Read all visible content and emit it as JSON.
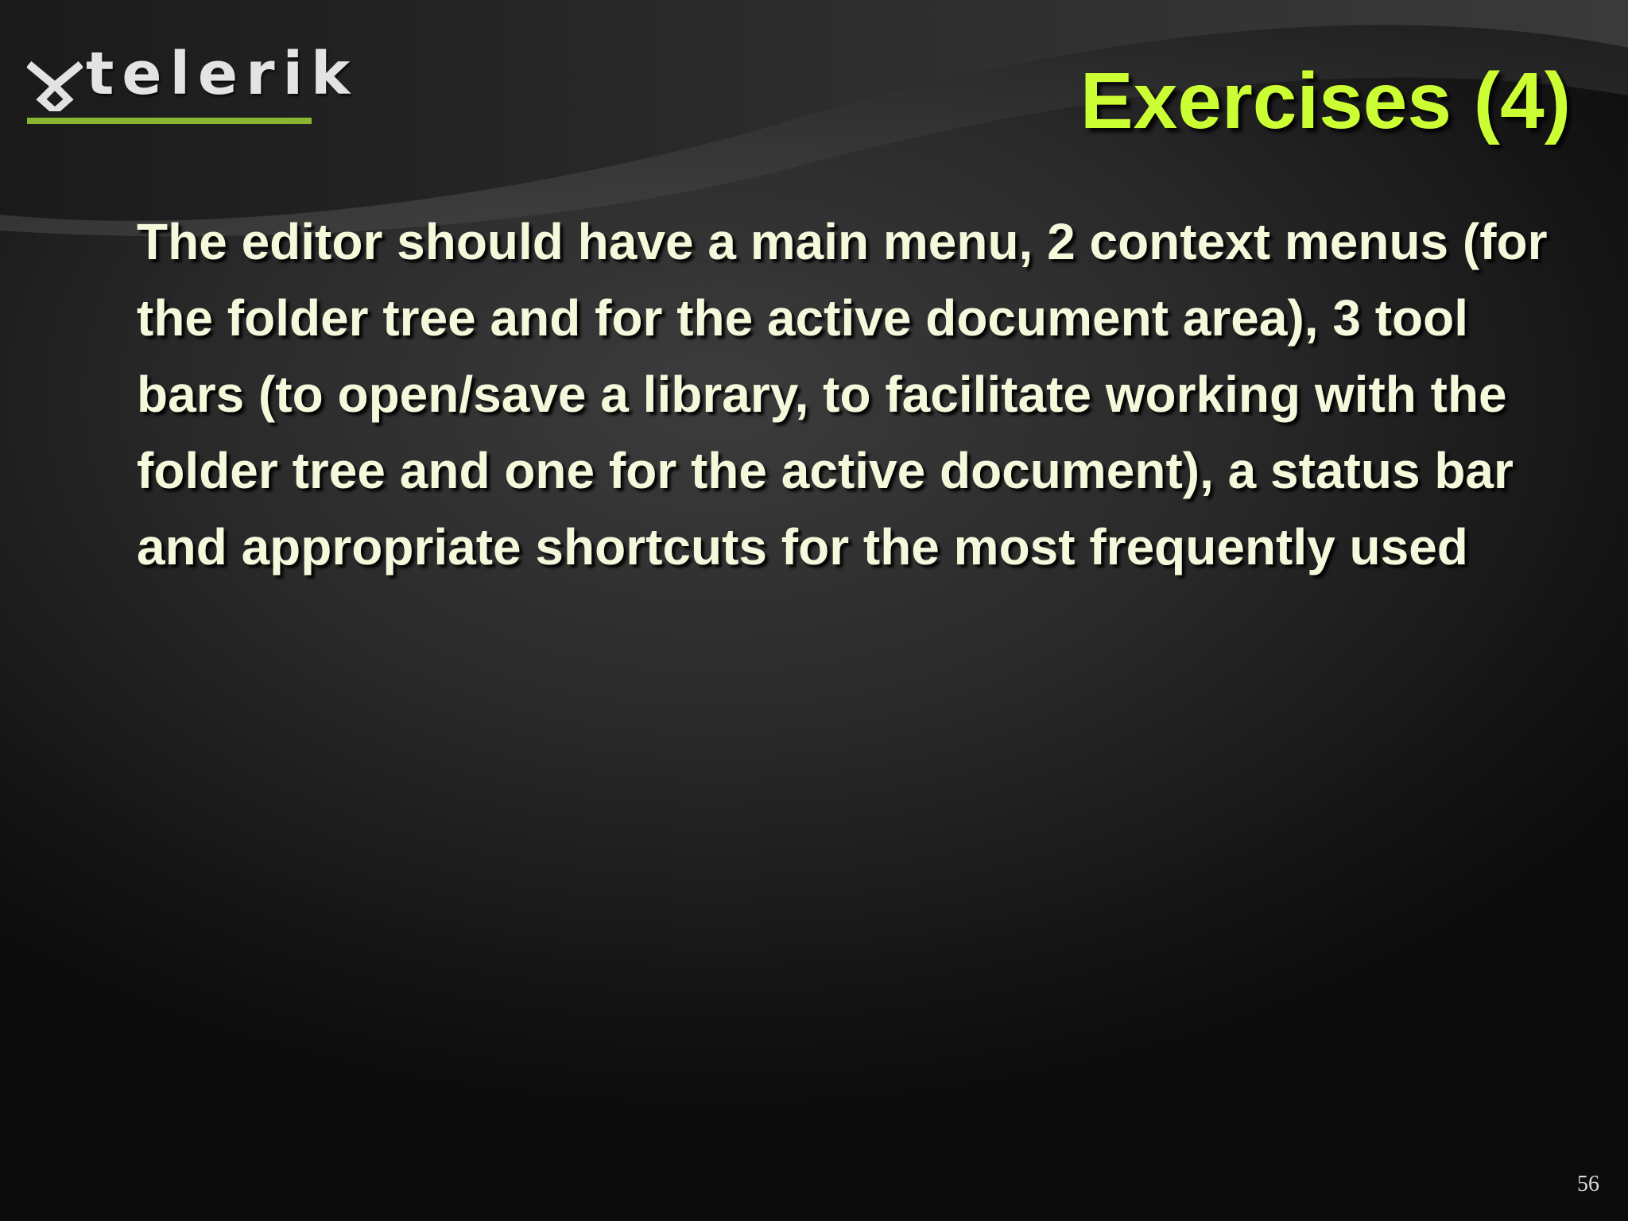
{
  "brand": {
    "name": "telerik",
    "accent_color": "#8ab532",
    "logo_icon": "telerik-mark-icon"
  },
  "slide": {
    "title": "Exercises (4)",
    "title_color": "#ccff33",
    "body_color": "#f4f9dc",
    "body": "The editor should have a main menu, 2 context menus (for the folder tree and for the active document area), 3 tool bars (to open/save a library, to facilitate working with the folder tree and one for the active document), a status bar and appropriate shortcuts for the most frequently used",
    "page_number": "56"
  }
}
